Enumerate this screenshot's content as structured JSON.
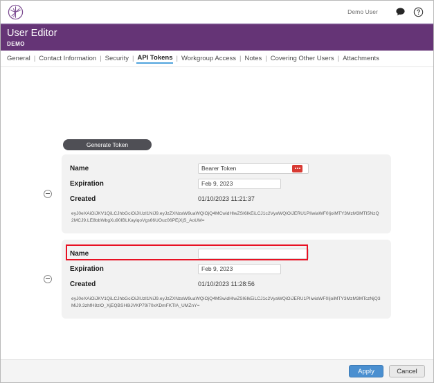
{
  "topbar": {
    "logo_name": "app-logo",
    "user_label": "Demo User",
    "chat_icon": "chat-bubble-icon",
    "help_icon": "help-circle-icon"
  },
  "header": {
    "title": "User Editor",
    "subtitle": "DEMO",
    "background_color": "#653476"
  },
  "tabs": {
    "separator": "|",
    "active_underline_color": "#4fa3dd",
    "items": [
      {
        "label": "General",
        "active": false
      },
      {
        "label": "Contact Information",
        "active": false
      },
      {
        "label": "Security",
        "active": false
      },
      {
        "label": "API Tokens",
        "active": true
      },
      {
        "label": "Workgroup Access",
        "active": false
      },
      {
        "label": "Notes",
        "active": false
      },
      {
        "label": "Covering Other Users",
        "active": false
      },
      {
        "label": "Attachments",
        "active": false
      }
    ]
  },
  "toolbar": {
    "generate_token_label": "Generate Token"
  },
  "labels": {
    "name": "Name",
    "expiration": "Expiration",
    "created": "Created"
  },
  "tokens": [
    {
      "name_value": "Bearer Token",
      "name_placeholder": "",
      "expiration_value": "Feb 9, 2023",
      "created_value": "01/10/2023 11:21:37",
      "jwt": "eyJ0eXAiOiJKV1QiLCJhbGciOiJIUzI1NiJ9.eyJzZXNzaW9uaWQiOjQ4MCwidHlwZSI6IkEiLCJ1c2VyaWQiOiJERU1PIiwiaWF0IjoiMTY3MzM3MTI5NzQ2MCJ9.LE8bbWbgXu90IBLKayiqoVgs66UOuz06PEjXjS_AoUM=",
      "mask_button_color": "#d83a33",
      "mask_button_name": "mask-token-button",
      "highlighted": false
    },
    {
      "name_value": "",
      "name_placeholder": "",
      "expiration_value": "Feb 9, 2023",
      "created_value": "01/10/2023 11:28:56",
      "jwt": "eyJ0eXAiOiJKV1QiLCJhbGciOiJIUzI1NiJ9.eyJzZXNzaW9uaWQiOjQ4MSwidHlwZSI6IkEiLCJ1c2VyaWQiOiJERU1PIiwiaWF0IjoiMTY3MzM3MTczNjQ3MiJ9.3zhfH8zlO_XjEQBSH6lJVKP79i70xKDmFKTlA_UMZnY=",
      "mask_button_color": "#d83a33",
      "mask_button_name": "mask-token-button",
      "highlighted": true
    }
  ],
  "highlight": {
    "color": "#e81123"
  },
  "footer": {
    "apply_label": "Apply",
    "cancel_label": "Cancel",
    "apply_color": "#4a8fd0"
  }
}
